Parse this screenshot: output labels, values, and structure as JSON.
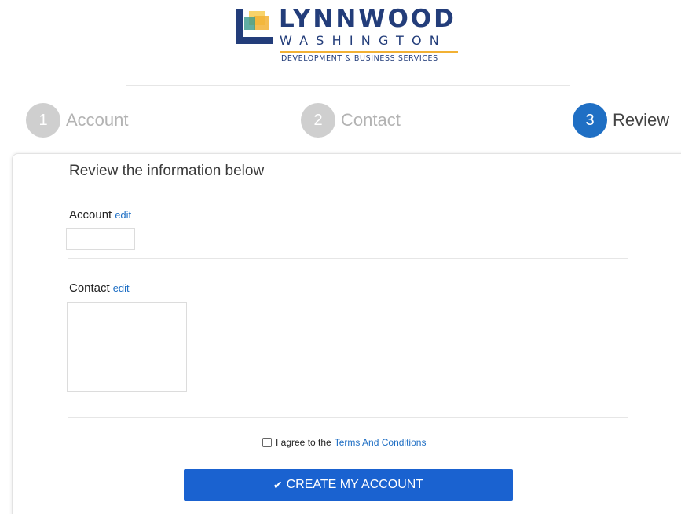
{
  "logo": {
    "title": "LYNNWOOD",
    "subtitle": "WASHINGTON",
    "tagline": "DEVELOPMENT & BUSINESS SERVICES"
  },
  "steps": [
    {
      "number": "1",
      "label": "Account",
      "active": false
    },
    {
      "number": "2",
      "label": "Contact",
      "active": false
    },
    {
      "number": "3",
      "label": "Review",
      "active": true
    }
  ],
  "review": {
    "heading": "Review the information below",
    "account": {
      "title": "Account",
      "edit_label": "edit"
    },
    "contact": {
      "title": "Contact",
      "edit_label": "edit"
    },
    "agree": {
      "prefix": "I agree to the",
      "link_label": "Terms And Conditions",
      "checked": false
    },
    "submit": {
      "icon": "check-icon",
      "label": "CREATE MY ACCOUNT"
    }
  },
  "colors": {
    "brand_navy": "#233d7a",
    "accent_blue": "#1f6fc4",
    "button_blue": "#1a62d0",
    "inactive_step": "#cfcfcf",
    "logo_orange": "#f2b134",
    "logo_yellow": "#f8d36a",
    "logo_teal": "#3a9a8c"
  }
}
